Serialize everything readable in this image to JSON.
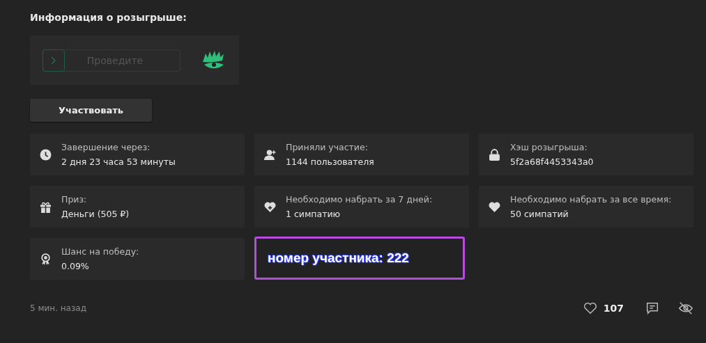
{
  "title": "Информация о розыгрыше:",
  "captcha": {
    "placeholder": "Проведите"
  },
  "join_button": "Участвовать",
  "cards": [
    {
      "label": "Завершение через:",
      "value": "2 дня 23 часа 53 минуты"
    },
    {
      "label": "Приняли участие:",
      "value": "1144 пользователя"
    },
    {
      "label": "Хэш розыгрыша:",
      "value": "5f2a68f4453343a0"
    },
    {
      "label": "Приз:",
      "value": "Деньги (505 ₽)"
    },
    {
      "label": "Необходимо набрать за 7 дней:",
      "value": "1 симпатию"
    },
    {
      "label": "Необходимо набрать за все время:",
      "value": "50 симпатий"
    },
    {
      "label": "Шанс на победу:",
      "value": "0.09%"
    }
  ],
  "annotation": "номер участника: 222",
  "footer": {
    "time": "5 мин. назад",
    "likes": "107"
  }
}
